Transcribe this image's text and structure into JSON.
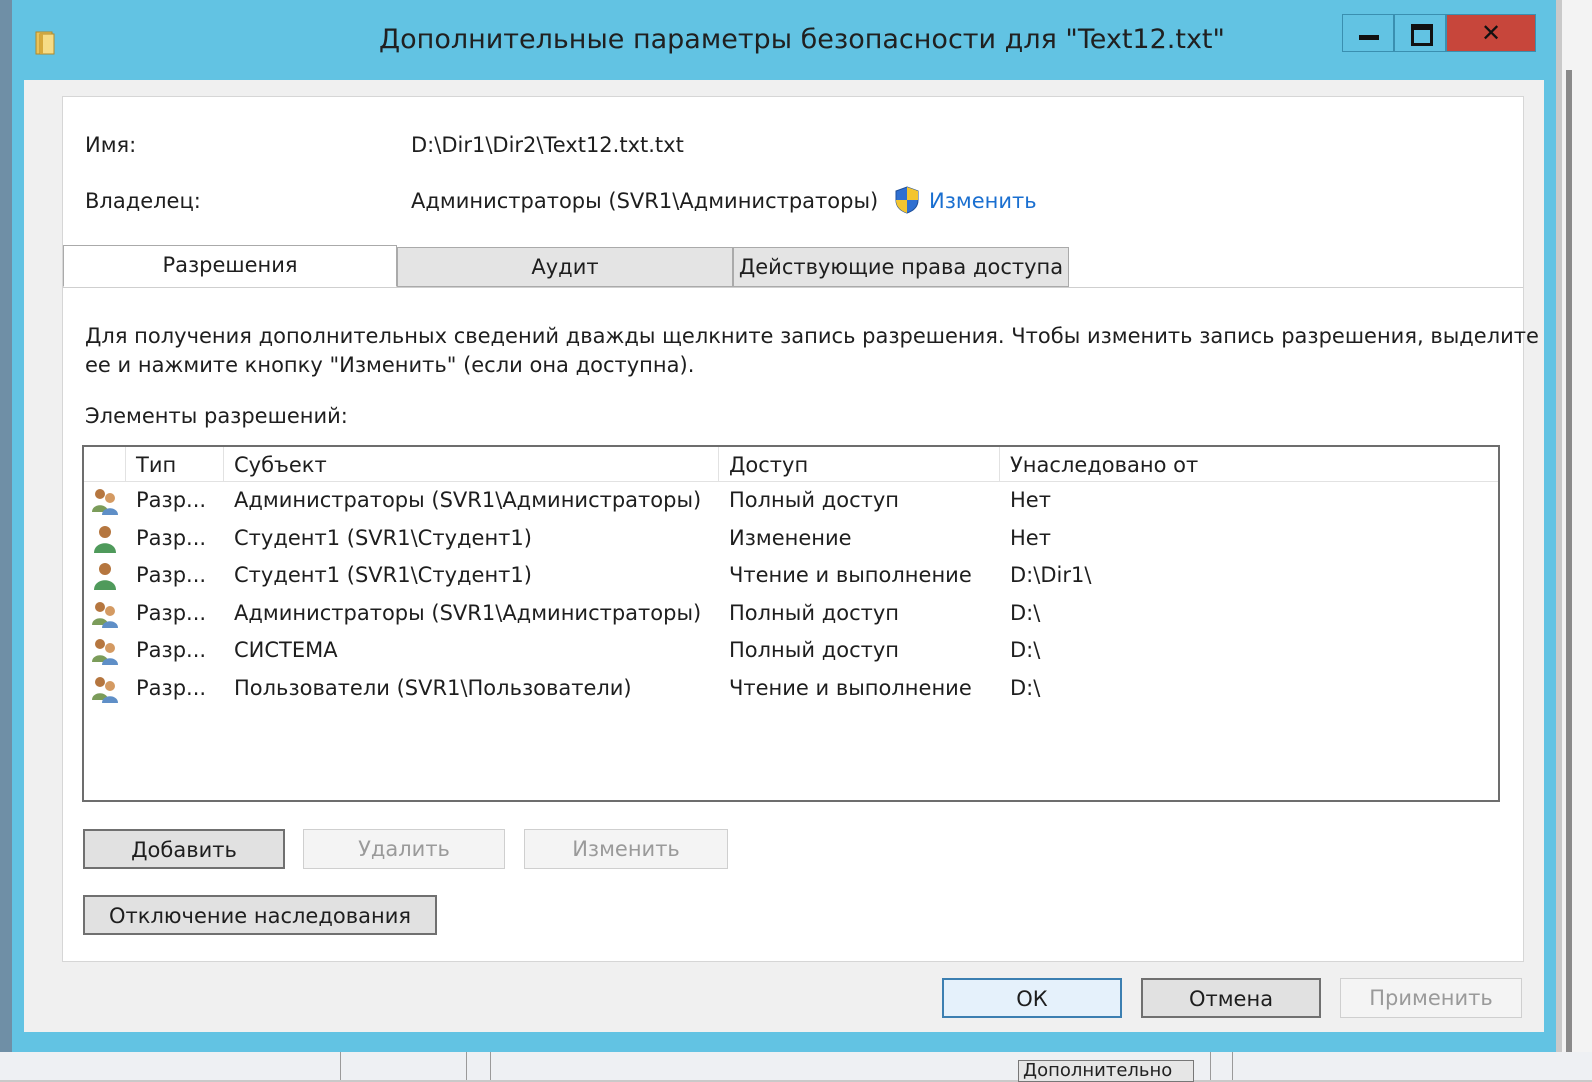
{
  "window": {
    "title": "Дополнительные параметры безопасности  для \"Text12.txt\"",
    "minimize_glyph": "",
    "close_glyph": "✕"
  },
  "info": {
    "name_label": "Имя:",
    "name_value": "D:\\Dir1\\Dir2\\Text12.txt.txt",
    "owner_label": "Владелец:",
    "owner_value": "Администраторы (SVR1\\Администраторы)",
    "change_link": "Изменить"
  },
  "tabs": [
    {
      "label": "Разрешения",
      "active": true
    },
    {
      "label": "Аудит",
      "active": false
    },
    {
      "label": "Действующие права доступа",
      "active": false
    }
  ],
  "description": {
    "line1": "Для получения дополнительных сведений дважды щелкните запись разрешения. Чтобы изменить запись разрешения, выделите",
    "line2": "ее и нажмите кнопку \"Изменить\" (если она доступна)."
  },
  "list_title": "Элементы разрешений:",
  "columns": {
    "type": "Тип",
    "subject": "Субъект",
    "access": "Доступ",
    "inherited": "Унаследовано от"
  },
  "rows": [
    {
      "icon": "group-icon",
      "type": "Разр...",
      "subject": "Администраторы (SVR1\\Администраторы)",
      "access": "Полный доступ",
      "inherited": "Нет"
    },
    {
      "icon": "user-icon",
      "type": "Разр...",
      "subject": "Студент1 (SVR1\\Студент1)",
      "access": "Изменение",
      "inherited": "Нет"
    },
    {
      "icon": "user-icon",
      "type": "Разр...",
      "subject": "Студент1 (SVR1\\Студент1)",
      "access": "Чтение и выполнение",
      "inherited": "D:\\Dir1\\"
    },
    {
      "icon": "group-icon",
      "type": "Разр...",
      "subject": "Администраторы (SVR1\\Администраторы)",
      "access": "Полный доступ",
      "inherited": "D:\\"
    },
    {
      "icon": "group-icon",
      "type": "Разр...",
      "subject": "СИСТЕМА",
      "access": "Полный доступ",
      "inherited": "D:\\"
    },
    {
      "icon": "group-icon",
      "type": "Разр...",
      "subject": "Пользователи (SVR1\\Пользователи)",
      "access": "Чтение и выполнение",
      "inherited": "D:\\"
    }
  ],
  "buttons": {
    "add": "Добавить",
    "remove": "Удалить",
    "edit": "Изменить",
    "disable_inheritance": "Отключение наследования",
    "ok": "ОК",
    "cancel": "Отмена",
    "apply": "Применить"
  },
  "background": {
    "partial_button": "Дополнительно"
  },
  "colors": {
    "titlebar": "#62c3e3",
    "close_button": "#c7463b",
    "link": "#1a6fd0"
  }
}
